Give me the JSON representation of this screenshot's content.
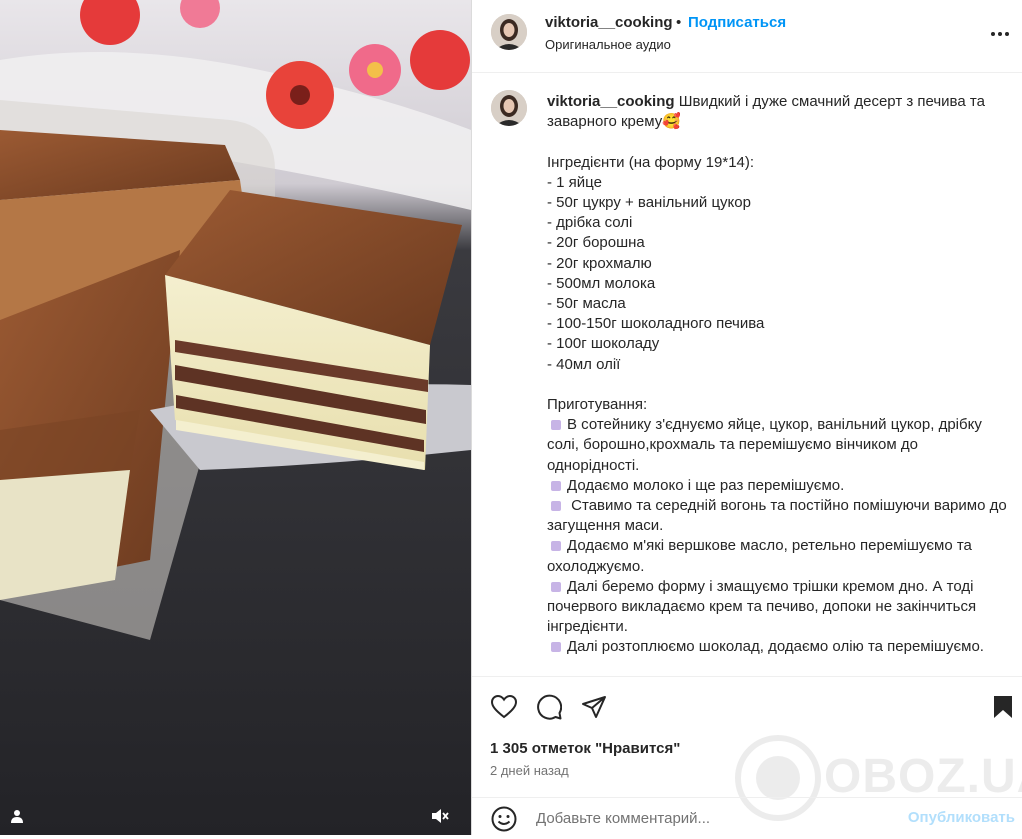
{
  "post": {
    "username": "viktoria__cooking",
    "separator": "•",
    "follow_label": "Подписаться",
    "audio_label": "Оригинальное аудио"
  },
  "caption": {
    "username": "viktoria__cooking",
    "lines": [
      "Швидкий і дуже смачний десерт з печива та заварного крему🥰",
      "",
      "Інгредієнти (на форму 19*14):",
      "- 1 яйце",
      "- 50г цукру + ванільний цукор",
      "- дрібка солі",
      "- 20г борошна",
      "- 20г крохмалю",
      "- 500мл молока",
      "- 50г масла",
      "- 100-150г шоколадного печива",
      "- 100г шоколаду",
      "- 40мл олії",
      "",
      "Приготування:",
      "В сотейнику з'єднуємо яйце, цукор, ванільний цукор, дрібку солі, борошно,крохмаль та перемішуємо вінчиком до однорідності.",
      "Додаємо молоко і ще раз перемішуємо.",
      " Ставимо та середній вогонь та постійно помішуючи варимо до загущення маси.",
      "Додаємо м'які вершкове масло, ретельно перемішуємо та охолоджуємо.",
      "Далі беремо форму і змащуємо трішки кремом дно. А тоді почервого викладаємо крем та печиво, допоки не закінчиться інгредієнти.",
      "Далі розтоплюємо шоколад, додаємо олію та перемішуємо."
    ]
  },
  "actions": {
    "likes": "1 305 отметок \"Нравится\"",
    "date": "2 дней назад",
    "comment_placeholder": "Добавьте комментарий...",
    "publish_label": "Опубликовать"
  },
  "watermark": {
    "text": "OBOZ.UA"
  },
  "icons": {
    "like": "heart-icon",
    "comment": "comment-icon",
    "share": "send-icon",
    "save": "bookmark-icon",
    "more": "more-options-icon",
    "emoji": "emoji-icon",
    "tagged_user": "user-icon",
    "audio": "mute-icon"
  },
  "colors": {
    "link": "#0095f6",
    "publish_disabled": "#b2dffc",
    "list_marker": "#c7b4e6"
  }
}
